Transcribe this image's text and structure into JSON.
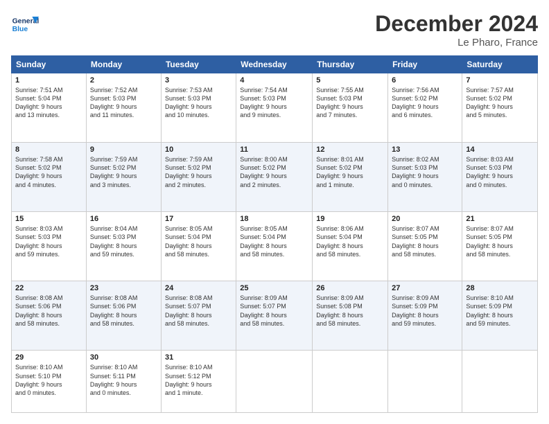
{
  "header": {
    "logo": {
      "general": "General",
      "blue": "Blue"
    },
    "title": "December 2024",
    "location": "Le Pharo, France"
  },
  "days_of_week": [
    "Sunday",
    "Monday",
    "Tuesday",
    "Wednesday",
    "Thursday",
    "Friday",
    "Saturday"
  ],
  "weeks": [
    [
      {
        "day": 1,
        "info": "Sunrise: 7:51 AM\nSunset: 5:04 PM\nDaylight: 9 hours\nand 13 minutes."
      },
      {
        "day": 2,
        "info": "Sunrise: 7:52 AM\nSunset: 5:03 PM\nDaylight: 9 hours\nand 11 minutes."
      },
      {
        "day": 3,
        "info": "Sunrise: 7:53 AM\nSunset: 5:03 PM\nDaylight: 9 hours\nand 10 minutes."
      },
      {
        "day": 4,
        "info": "Sunrise: 7:54 AM\nSunset: 5:03 PM\nDaylight: 9 hours\nand 9 minutes."
      },
      {
        "day": 5,
        "info": "Sunrise: 7:55 AM\nSunset: 5:03 PM\nDaylight: 9 hours\nand 7 minutes."
      },
      {
        "day": 6,
        "info": "Sunrise: 7:56 AM\nSunset: 5:02 PM\nDaylight: 9 hours\nand 6 minutes."
      },
      {
        "day": 7,
        "info": "Sunrise: 7:57 AM\nSunset: 5:02 PM\nDaylight: 9 hours\nand 5 minutes."
      }
    ],
    [
      {
        "day": 8,
        "info": "Sunrise: 7:58 AM\nSunset: 5:02 PM\nDaylight: 9 hours\nand 4 minutes."
      },
      {
        "day": 9,
        "info": "Sunrise: 7:59 AM\nSunset: 5:02 PM\nDaylight: 9 hours\nand 3 minutes."
      },
      {
        "day": 10,
        "info": "Sunrise: 7:59 AM\nSunset: 5:02 PM\nDaylight: 9 hours\nand 2 minutes."
      },
      {
        "day": 11,
        "info": "Sunrise: 8:00 AM\nSunset: 5:02 PM\nDaylight: 9 hours\nand 2 minutes."
      },
      {
        "day": 12,
        "info": "Sunrise: 8:01 AM\nSunset: 5:02 PM\nDaylight: 9 hours\nand 1 minute."
      },
      {
        "day": 13,
        "info": "Sunrise: 8:02 AM\nSunset: 5:03 PM\nDaylight: 9 hours\nand 0 minutes."
      },
      {
        "day": 14,
        "info": "Sunrise: 8:03 AM\nSunset: 5:03 PM\nDaylight: 9 hours\nand 0 minutes."
      }
    ],
    [
      {
        "day": 15,
        "info": "Sunrise: 8:03 AM\nSunset: 5:03 PM\nDaylight: 8 hours\nand 59 minutes."
      },
      {
        "day": 16,
        "info": "Sunrise: 8:04 AM\nSunset: 5:03 PM\nDaylight: 8 hours\nand 59 minutes."
      },
      {
        "day": 17,
        "info": "Sunrise: 8:05 AM\nSunset: 5:04 PM\nDaylight: 8 hours\nand 58 minutes."
      },
      {
        "day": 18,
        "info": "Sunrise: 8:05 AM\nSunset: 5:04 PM\nDaylight: 8 hours\nand 58 minutes."
      },
      {
        "day": 19,
        "info": "Sunrise: 8:06 AM\nSunset: 5:04 PM\nDaylight: 8 hours\nand 58 minutes."
      },
      {
        "day": 20,
        "info": "Sunrise: 8:07 AM\nSunset: 5:05 PM\nDaylight: 8 hours\nand 58 minutes."
      },
      {
        "day": 21,
        "info": "Sunrise: 8:07 AM\nSunset: 5:05 PM\nDaylight: 8 hours\nand 58 minutes."
      }
    ],
    [
      {
        "day": 22,
        "info": "Sunrise: 8:08 AM\nSunset: 5:06 PM\nDaylight: 8 hours\nand 58 minutes."
      },
      {
        "day": 23,
        "info": "Sunrise: 8:08 AM\nSunset: 5:06 PM\nDaylight: 8 hours\nand 58 minutes."
      },
      {
        "day": 24,
        "info": "Sunrise: 8:08 AM\nSunset: 5:07 PM\nDaylight: 8 hours\nand 58 minutes."
      },
      {
        "day": 25,
        "info": "Sunrise: 8:09 AM\nSunset: 5:07 PM\nDaylight: 8 hours\nand 58 minutes."
      },
      {
        "day": 26,
        "info": "Sunrise: 8:09 AM\nSunset: 5:08 PM\nDaylight: 8 hours\nand 58 minutes."
      },
      {
        "day": 27,
        "info": "Sunrise: 8:09 AM\nSunset: 5:09 PM\nDaylight: 8 hours\nand 59 minutes."
      },
      {
        "day": 28,
        "info": "Sunrise: 8:10 AM\nSunset: 5:09 PM\nDaylight: 8 hours\nand 59 minutes."
      }
    ],
    [
      {
        "day": 29,
        "info": "Sunrise: 8:10 AM\nSunset: 5:10 PM\nDaylight: 9 hours\nand 0 minutes."
      },
      {
        "day": 30,
        "info": "Sunrise: 8:10 AM\nSunset: 5:11 PM\nDaylight: 9 hours\nand 0 minutes."
      },
      {
        "day": 31,
        "info": "Sunrise: 8:10 AM\nSunset: 5:12 PM\nDaylight: 9 hours\nand 1 minute."
      },
      null,
      null,
      null,
      null
    ]
  ]
}
